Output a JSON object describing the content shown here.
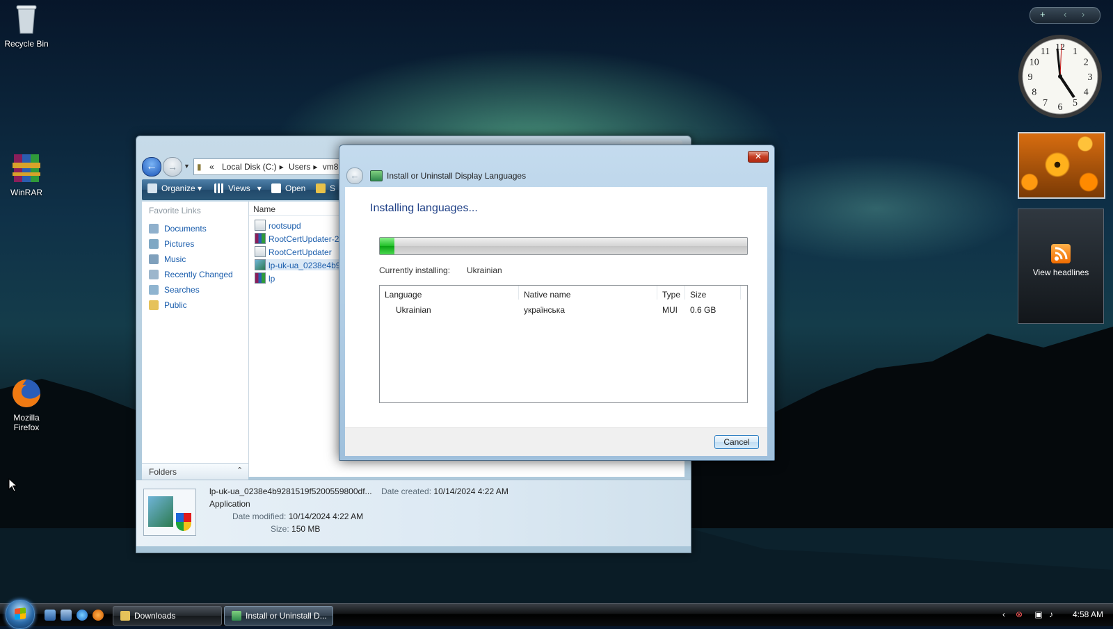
{
  "desktop": {
    "icons": [
      {
        "label": "Recycle Bin"
      },
      {
        "label": "WinRAR"
      },
      {
        "label": "Mozilla Firefox"
      }
    ]
  },
  "gadgets": {
    "bar_buttons": [
      "+",
      "‹",
      "›"
    ],
    "clock_numerals": [
      "12",
      "1",
      "2",
      "3",
      "4",
      "5",
      "6",
      "7",
      "8",
      "9",
      "10",
      "11"
    ],
    "feed_label": "View headlines"
  },
  "explorer": {
    "address": {
      "prefix": "«",
      "segments": [
        "Local Disk (C:)",
        "Users",
        "vm8"
      ]
    },
    "toolbar": {
      "organize": "Organize",
      "views": "Views",
      "open": "Open",
      "share_partial": "S"
    },
    "favorite_links_title": "Favorite Links",
    "favorite_links": [
      "Documents",
      "Pictures",
      "Music",
      "Recently Changed",
      "Searches",
      "Public"
    ],
    "folders_label": "Folders",
    "name_column": "Name",
    "files": [
      "rootsupd",
      "RootCertUpdater-2",
      "RootCertUpdater",
      "lp-uk-ua_0238e4b9",
      "lp"
    ],
    "details": {
      "filename": "lp-uk-ua_0238e4b9281519f5200559800df...",
      "type": "Application",
      "date_created_label": "Date created:",
      "date_created": "10/14/2024 4:22 AM",
      "date_modified_label": "Date modified:",
      "date_modified": "10/14/2024 4:22 AM",
      "size_label": "Size:",
      "size": "150 MB"
    }
  },
  "dialog": {
    "title": "Install or Uninstall Display Languages",
    "heading": "Installing languages...",
    "progress_fraction": 0.04,
    "currently_installing_label": "Currently installing:",
    "currently_installing_value": "Ukrainian",
    "table": {
      "headers": [
        "Language",
        "Native name",
        "Type",
        "Size"
      ],
      "rows": [
        {
          "language": "Ukrainian",
          "native": "українська",
          "type": "MUI",
          "size": "0.6 GB"
        }
      ]
    },
    "cancel_label": "Cancel"
  },
  "taskbar": {
    "buttons": [
      {
        "label": "Downloads"
      },
      {
        "label": "Install or Uninstall D..."
      }
    ],
    "time": "4:58 AM"
  }
}
